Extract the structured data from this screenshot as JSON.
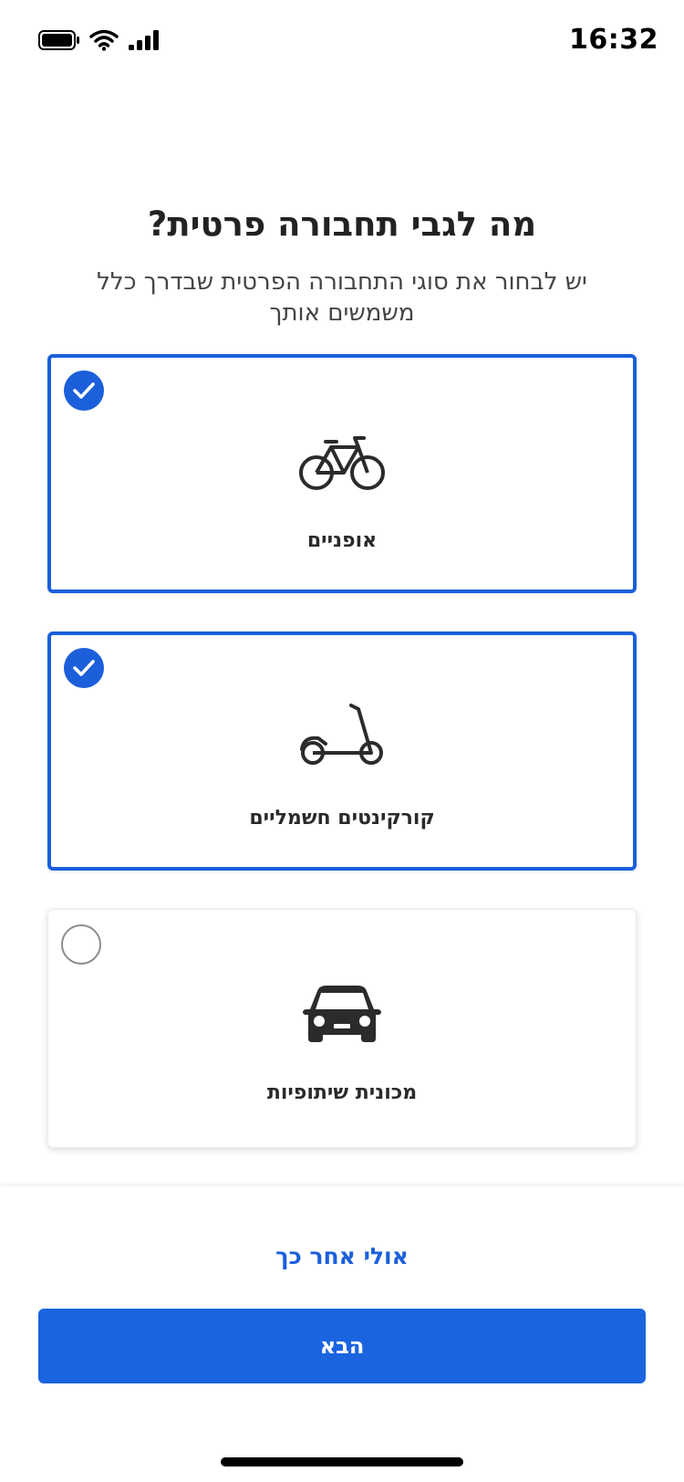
{
  "status_bar": {
    "time": "16:32",
    "icons": [
      "battery-icon",
      "wifi-icon",
      "cellular-signal-icon"
    ]
  },
  "header": {
    "title": "מה לגבי תחבורה פרטית?",
    "subtitle": "יש לבחור את סוגי התחבורה הפרטית שבדרך כלל משמשים אותך"
  },
  "options": [
    {
      "label": "אופניים",
      "icon": "bicycle-icon",
      "selected": true
    },
    {
      "label": "קורקינטים חשמליים",
      "icon": "electric-scooter-icon",
      "selected": true
    },
    {
      "label": "מכונית שיתופיות",
      "icon": "car-icon",
      "selected": false
    }
  ],
  "footer": {
    "later_label": "אולי אחר כך",
    "next_label": "הבא"
  },
  "colors": {
    "accent": "#1b5fdb",
    "button": "#1b64e0"
  }
}
